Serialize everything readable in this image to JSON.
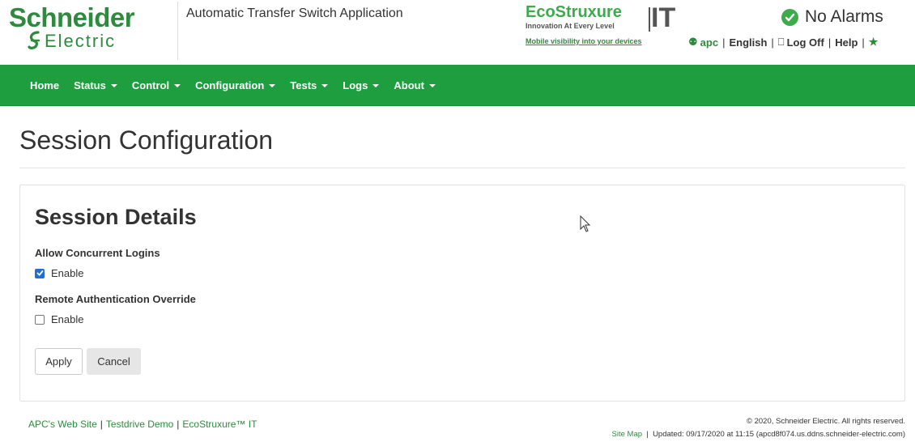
{
  "header": {
    "brand_line1": "Schneider",
    "brand_line2": "Electric",
    "app_title": "Automatic Transfer Switch Application",
    "eco_brand": "EcoStruxure",
    "eco_it": "IT",
    "eco_tagline": "Innovation At Every Level",
    "eco_link": "Mobile visibility into your devices",
    "alarm_status": "No Alarms",
    "alarm_color": "#3dab4b",
    "user_bar": {
      "user": "apc",
      "language": "English",
      "logoff": "Log Off",
      "help": "Help"
    }
  },
  "nav": {
    "items": [
      {
        "label": "Home",
        "dropdown": false
      },
      {
        "label": "Status",
        "dropdown": true
      },
      {
        "label": "Control",
        "dropdown": true
      },
      {
        "label": "Configuration",
        "dropdown": true
      },
      {
        "label": "Tests",
        "dropdown": true
      },
      {
        "label": "Logs",
        "dropdown": true
      },
      {
        "label": "About",
        "dropdown": true
      }
    ],
    "bg_color": "#1e9e3e"
  },
  "main": {
    "page_title": "Session Configuration",
    "panel_title": "Session Details",
    "fields": [
      {
        "label": "Allow Concurrent Logins",
        "option": "Enable",
        "checked": true
      },
      {
        "label": "Remote Authentication Override",
        "option": "Enable",
        "checked": false
      }
    ],
    "apply_label": "Apply",
    "cancel_label": "Cancel"
  },
  "footer": {
    "links": [
      "APC's Web Site",
      "Testdrive Demo",
      "EcoStruxure™ IT"
    ],
    "copyright": "© 2020, Schneider Electric. All rights reserved.",
    "site_map": "Site Map",
    "updated": "Updated: 09/17/2020 at 11:15 (apcd8f074.us.ddns.schneider-electric.com)"
  }
}
